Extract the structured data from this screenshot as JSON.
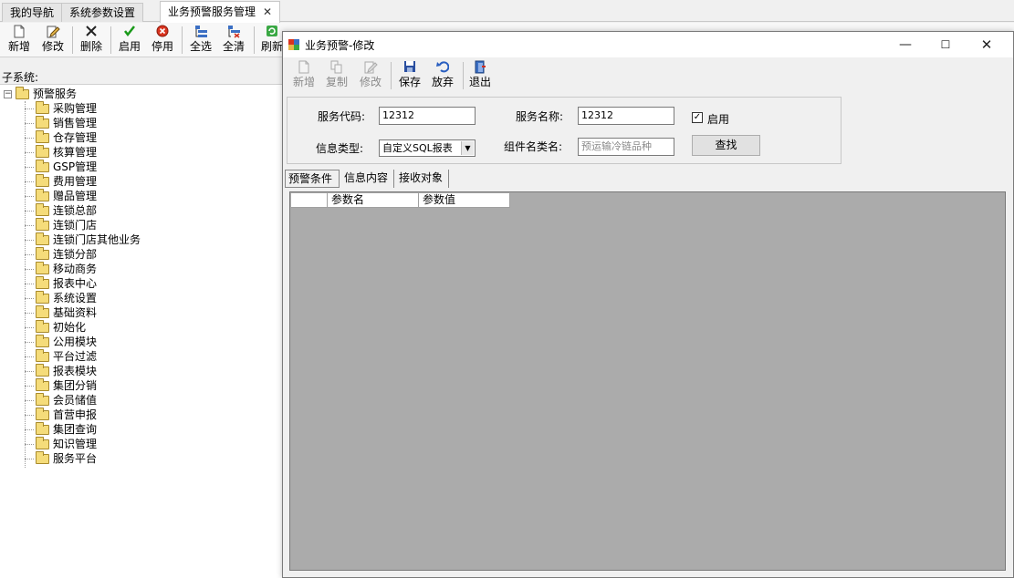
{
  "tabs": [
    {
      "label": "我的导航"
    },
    {
      "label": "系统参数设置"
    },
    {
      "label": "业务预警服务管理",
      "close": "✕"
    }
  ],
  "main_toolbar": {
    "buttons": [
      {
        "label": "新增",
        "icon": "new-doc-icon"
      },
      {
        "label": "修改",
        "icon": "edit-icon"
      },
      {
        "label": "删除",
        "icon": "delete-icon"
      },
      {
        "label": "启用",
        "icon": "check-icon"
      },
      {
        "label": "停用",
        "icon": "stop-icon"
      },
      {
        "label": "全选",
        "icon": "select-all-icon"
      },
      {
        "label": "全清",
        "icon": "clear-all-icon"
      },
      {
        "label": "刷新",
        "icon": "refresh-icon"
      }
    ]
  },
  "sidebar": {
    "subsystem_label": "子系统:",
    "root": {
      "label": "预警服务",
      "expander": "−"
    },
    "items": [
      {
        "label": "采购管理"
      },
      {
        "label": "销售管理"
      },
      {
        "label": "仓存管理"
      },
      {
        "label": "核算管理"
      },
      {
        "label": "GSP管理"
      },
      {
        "label": "费用管理"
      },
      {
        "label": "赠品管理"
      },
      {
        "label": "连锁总部"
      },
      {
        "label": "连锁门店"
      },
      {
        "label": "连锁门店其他业务"
      },
      {
        "label": "连锁分部"
      },
      {
        "label": "移动商务"
      },
      {
        "label": "报表中心"
      },
      {
        "label": "系统设置"
      },
      {
        "label": "基础资料"
      },
      {
        "label": "初始化"
      },
      {
        "label": "公用模块"
      },
      {
        "label": "平台过滤"
      },
      {
        "label": "报表模块"
      },
      {
        "label": "集团分销"
      },
      {
        "label": "会员储值"
      },
      {
        "label": "首营申报"
      },
      {
        "label": "集团查询"
      },
      {
        "label": "知识管理"
      },
      {
        "label": "服务平台"
      }
    ]
  },
  "dialog": {
    "title": "业务预警-修改",
    "window_buttons": {
      "minimize": "—",
      "maximize": "☐",
      "close": "✕"
    },
    "toolbar": [
      {
        "label": "新增",
        "icon": "new-doc-icon",
        "enabled": false
      },
      {
        "label": "复制",
        "icon": "copy-icon",
        "enabled": false
      },
      {
        "label": "修改",
        "icon": "edit-icon",
        "enabled": false
      },
      {
        "label": "保存",
        "icon": "save-icon",
        "enabled": true
      },
      {
        "label": "放弃",
        "icon": "undo-icon",
        "enabled": true
      },
      {
        "label": "退出",
        "icon": "exit-icon",
        "enabled": true
      }
    ],
    "form": {
      "service_code_label": "服务代码:",
      "service_code_value": "12312",
      "service_name_label": "服务名称:",
      "service_name_value": "12312",
      "enabled_label": "启用",
      "enabled_checked": true,
      "info_type_label": "信息类型:",
      "info_type_value": "自定义SQL报表",
      "component_label": "组件名类名:",
      "component_placeholder": "预运输冷链品种",
      "find_button": "查找"
    },
    "subtabs": [
      {
        "label": "预警条件",
        "active": true
      },
      {
        "label": "信息内容",
        "active": false
      },
      {
        "label": "接收对象",
        "active": false
      }
    ],
    "grid": {
      "columns": [
        "",
        "参数名",
        "参数值"
      ]
    }
  },
  "colors": {
    "grid_background": "#ababab",
    "folder": "#f5dc7a",
    "window_background": "#f0f0f0"
  }
}
